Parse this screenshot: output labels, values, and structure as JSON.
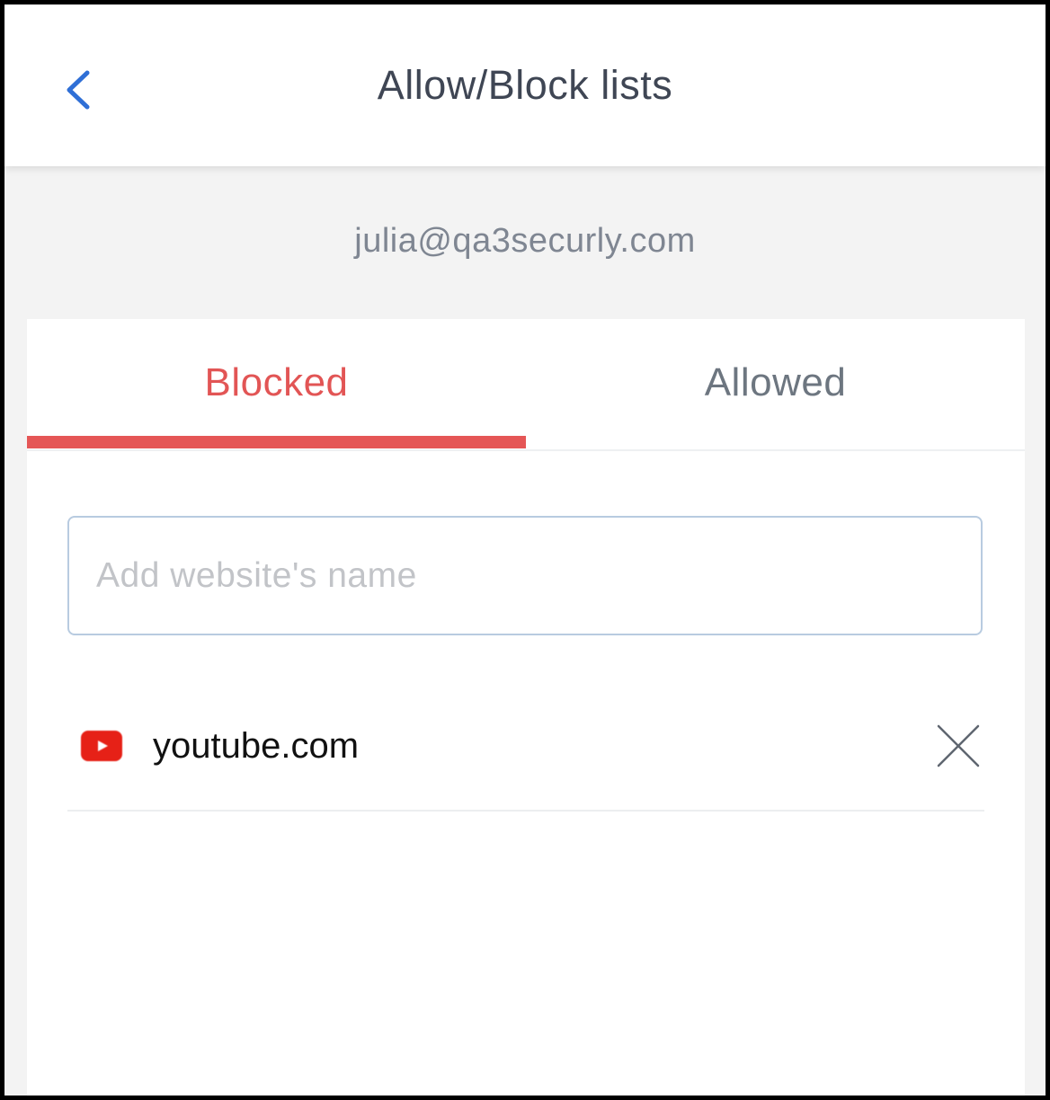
{
  "header": {
    "title": "Allow/Block lists",
    "back_icon": "chevron-left-icon",
    "accent_color": "#2f6fd6"
  },
  "account": {
    "email": "julia@qa3securly.com"
  },
  "tabs": [
    {
      "label": "Blocked",
      "active": true,
      "color": "#e25555"
    },
    {
      "label": "Allowed",
      "active": false,
      "color": "#6d7680"
    }
  ],
  "site_input": {
    "value": "",
    "placeholder": "Add website's name"
  },
  "blocked_sites": [
    {
      "name": "youtube.com",
      "icon": "youtube-icon",
      "remove_icon": "close-icon"
    }
  ]
}
